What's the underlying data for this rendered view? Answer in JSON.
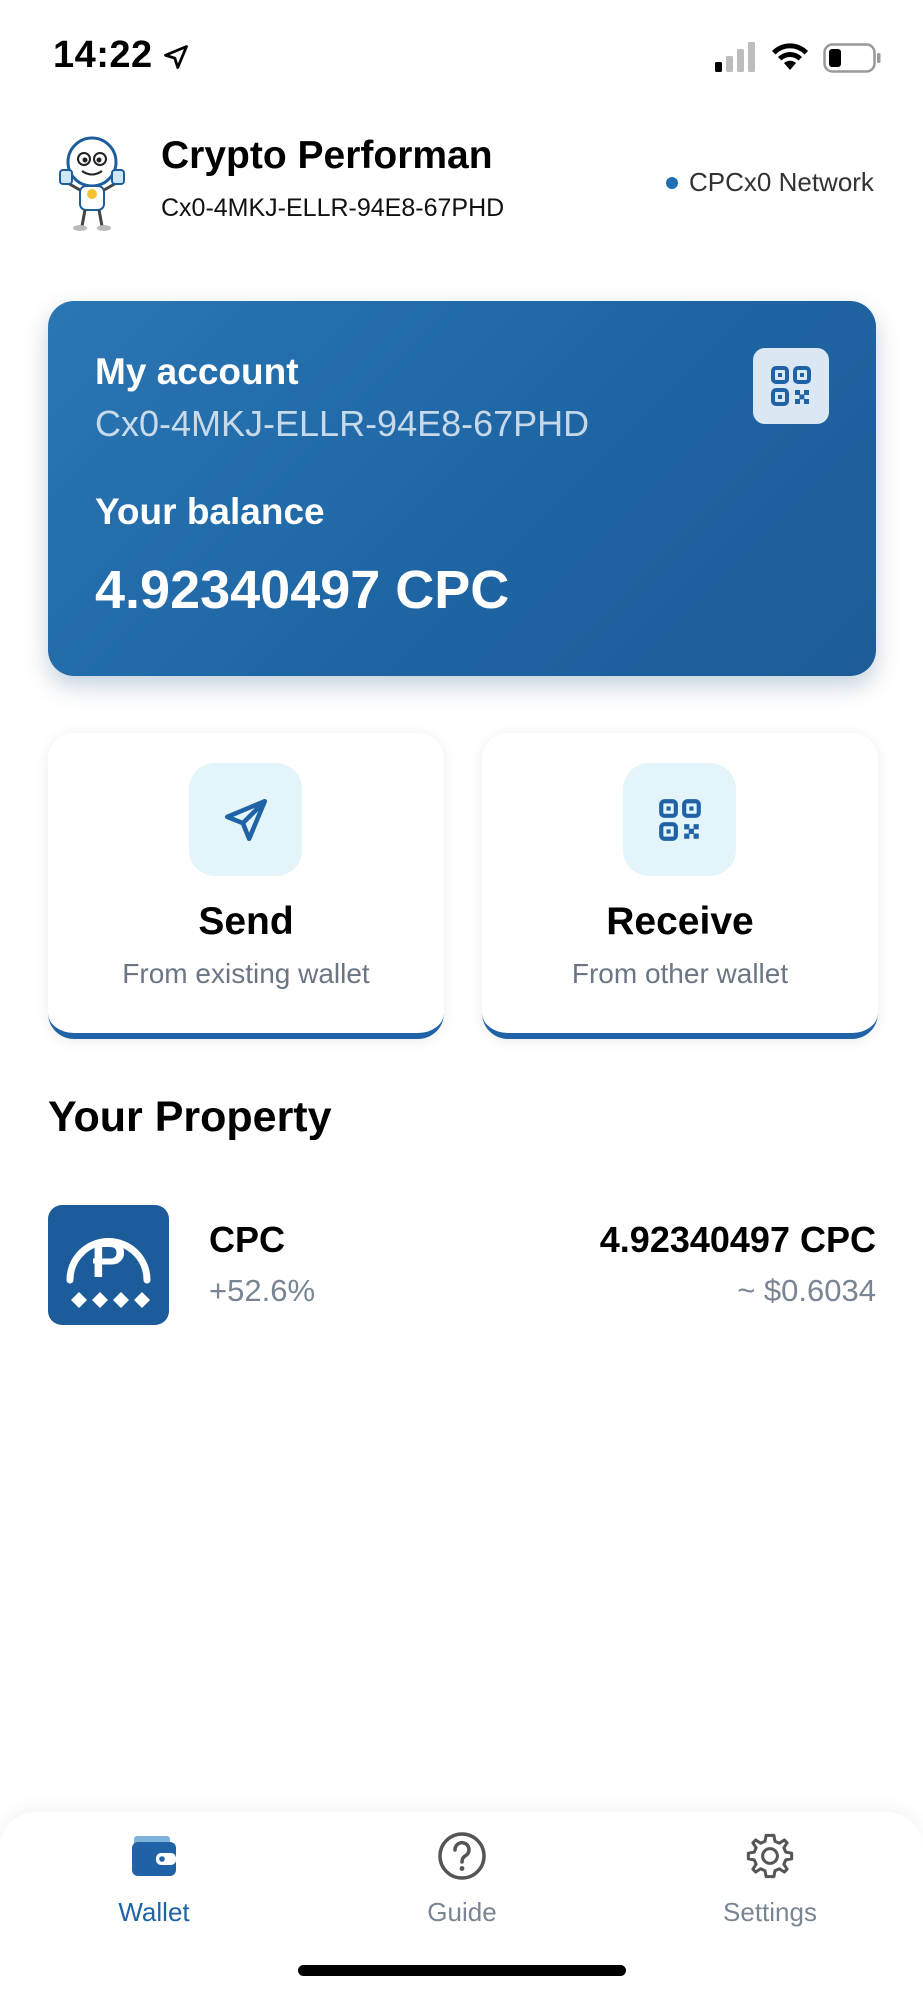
{
  "status_bar": {
    "time": "14:22"
  },
  "header": {
    "name": "Crypto Performan",
    "address": "Cx0-4MKJ-ELLR-94E8-67PHD",
    "network": "CPCx0 Network"
  },
  "account_card": {
    "title": "My account",
    "address": "Cx0-4MKJ-ELLR-94E8-67PHD",
    "balance_label": "Your balance",
    "balance_value": "4.92340497 CPC"
  },
  "actions": {
    "send": {
      "title": "Send",
      "subtitle": "From existing wallet",
      "icon": "paper-plane-icon"
    },
    "receive": {
      "title": "Receive",
      "subtitle": "From other wallet",
      "icon": "qr-code-icon"
    }
  },
  "property": {
    "heading": "Your Property",
    "assets": [
      {
        "name": "CPC",
        "change": "+52.6%",
        "amount": "4.92340497 CPC",
        "fiat": "~ $0.6034"
      }
    ]
  },
  "nav": {
    "items": [
      {
        "label": "Wallet",
        "icon": "wallet-icon",
        "active": true
      },
      {
        "label": "Guide",
        "icon": "question-icon",
        "active": false
      },
      {
        "label": "Settings",
        "icon": "gear-icon",
        "active": false
      }
    ]
  },
  "colors": {
    "primary": "#1f63a6",
    "accent_light": "#e3f4fb",
    "muted": "#7a8593"
  }
}
